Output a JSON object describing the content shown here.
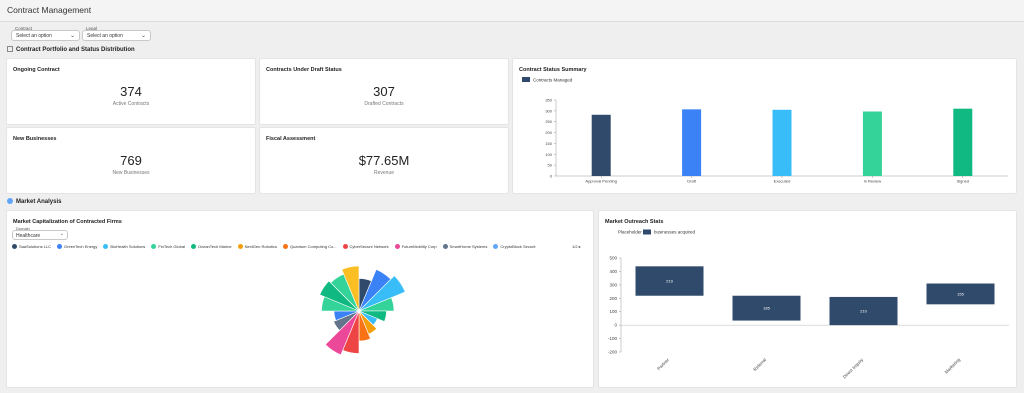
{
  "app": {
    "title": "Contract Management"
  },
  "filters": [
    {
      "label": "Contract Type",
      "value": "Select an option"
    },
    {
      "label": "Legal Counsel",
      "value": "Select an option"
    }
  ],
  "sections": {
    "portfolio": "Contract Portfolio and Status Distribution",
    "market": "Market Analysis"
  },
  "kpis": [
    {
      "title": "Ongoing Contract",
      "value": "374",
      "sub": "Active Contracts"
    },
    {
      "title": "Contracts Under Draft Status",
      "value": "307",
      "sub": "Drafted Contracts"
    },
    {
      "title": "New Businesses",
      "value": "769",
      "sub": "New Businesses"
    },
    {
      "title": "Fiscal Assessment",
      "value": "$77.65M",
      "sub": "Revenue"
    }
  ],
  "status_chart": {
    "title": "Contract Status Summary",
    "chart_data": {
      "type": "bar",
      "categories": [
        "Approval Pending",
        "Draft",
        "Executed",
        "In Review",
        "Signed"
      ],
      "series": [
        {
          "name": "Contracts Managed",
          "values": [
            282,
            307,
            305,
            297,
            310
          ]
        }
      ],
      "colors": [
        "#2f4a6b",
        "#3b82f6",
        "#38bdf8",
        "#34d399",
        "#10b981"
      ],
      "yticks": [
        "0",
        "50",
        "100",
        "150",
        "200",
        "250",
        "300",
        "350"
      ],
      "ylim": [
        0,
        350
      ]
    }
  },
  "market_cap": {
    "title": "Market Capitalization of Contracted Firms",
    "domain_label": "Domain",
    "domain_value": "Healthcare",
    "legend": [
      {
        "name": "SaaSolutions LLC",
        "color": "#2f4a6b"
      },
      {
        "name": "GreenTech Energy",
        "color": "#3b82f6"
      },
      {
        "name": "BioHealth Solutions",
        "color": "#38bdf8"
      },
      {
        "name": "FinTech Global",
        "color": "#34d399"
      },
      {
        "name": "OceanTech Marine",
        "color": "#10b981"
      },
      {
        "name": "NextGen Robotics",
        "color": "#f59e0b"
      },
      {
        "name": "Quantum Computing Co...",
        "color": "#f97316"
      },
      {
        "name": "CyberSecure Network",
        "color": "#ef4444"
      },
      {
        "name": "FutureMobility Corp",
        "color": "#ec4899"
      },
      {
        "name": "SmartHome Systems",
        "color": "#64748b"
      },
      {
        "name": "CryptoBlock Securit",
        "color": "#60a5fa"
      }
    ],
    "legend_pager": "1/2",
    "chart_data": {
      "type": "pie",
      "note_type": "nightingale-rose",
      "radii": [
        0.65,
        0.9,
        1.0,
        0.7,
        0.55,
        0.4,
        0.5,
        0.6,
        0.85,
        0.95,
        0.55,
        0.5,
        0.75,
        0.85,
        0.8,
        0.9
      ],
      "colors": [
        "#2f4a6b",
        "#3b82f6",
        "#38bdf8",
        "#34d399",
        "#10b981",
        "#38bdf8",
        "#f59e0b",
        "#f97316",
        "#ef4444",
        "#ec4899",
        "#64748b",
        "#3b82f6",
        "#34d399",
        "#10b981",
        "#34d399",
        "#fbbf24"
      ]
    }
  },
  "outreach": {
    "title": "Market Outreach Stats",
    "legend_placeholder": "Placeholder",
    "chart_data": {
      "type": "bar",
      "note_type": "waterfall",
      "categories": [
        "Partner",
        "Referral",
        "Direct Inquiry",
        "Marketing"
      ],
      "series": [
        {
          "name": "businesses acquired",
          "values": [
            219,
            185,
            210,
            155
          ]
        }
      ],
      "ranges": [
        [
          219,
          438
        ],
        [
          34,
          219
        ],
        [
          0,
          210
        ],
        [
          155,
          310
        ]
      ],
      "bar_labels": [
        "219",
        "185",
        "210",
        "155"
      ],
      "yticks": [
        "500",
        "400",
        "300",
        "200",
        "100",
        "0",
        "-100",
        "-200"
      ],
      "ylim": [
        -200,
        500
      ],
      "color": "#2f4a6b"
    }
  }
}
